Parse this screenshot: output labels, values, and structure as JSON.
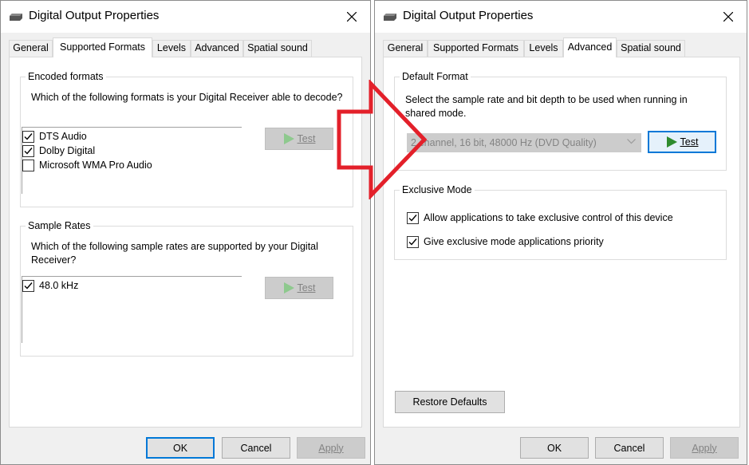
{
  "left_dialog": {
    "title": "Digital Output Properties",
    "tabs": [
      "General",
      "Supported Formats",
      "Levels",
      "Advanced",
      "Spatial sound"
    ],
    "active_tab": "Supported Formats",
    "encoded": {
      "legend": "Encoded formats",
      "description": "Which of the following formats is your Digital Receiver able to decode?",
      "items": [
        {
          "label": "DTS Audio",
          "checked": true
        },
        {
          "label": "Dolby Digital",
          "checked": true
        },
        {
          "label": "Microsoft WMA Pro Audio",
          "checked": false
        }
      ],
      "test_label": "Test"
    },
    "sample_rates": {
      "legend": "Sample Rates",
      "description": "Which of the following sample rates are supported by your Digital Receiver?",
      "items": [
        {
          "label": "48.0 kHz",
          "checked": true
        }
      ],
      "test_label": "Test"
    },
    "buttons": {
      "ok": "OK",
      "cancel": "Cancel",
      "apply": "Apply"
    }
  },
  "right_dialog": {
    "title": "Digital Output Properties",
    "tabs": [
      "General",
      "Supported Formats",
      "Levels",
      "Advanced",
      "Spatial sound"
    ],
    "active_tab": "Advanced",
    "default_format": {
      "legend": "Default Format",
      "description": "Select the sample rate and bit depth to be used when running in shared mode.",
      "selected_format": "2 channel, 16 bit, 48000 Hz (DVD Quality)",
      "test_label": "Test"
    },
    "exclusive_mode": {
      "legend": "Exclusive Mode",
      "options": [
        {
          "label": "Allow applications to take exclusive control of this device",
          "checked": true
        },
        {
          "label": "Give exclusive mode applications priority",
          "checked": true
        }
      ]
    },
    "restore_defaults": "Restore Defaults",
    "buttons": {
      "ok": "OK",
      "cancel": "Cancel",
      "apply": "Apply"
    }
  },
  "colors": {
    "annotation_arrow": "#e3202a",
    "play_green": "#2e8b2e",
    "focus_blue": "#0078d7"
  },
  "icons": [
    "speaker-device-icon",
    "close-icon",
    "checkmark-icon",
    "play-icon",
    "chevron-down-icon",
    "arrow-annotation-icon"
  ]
}
